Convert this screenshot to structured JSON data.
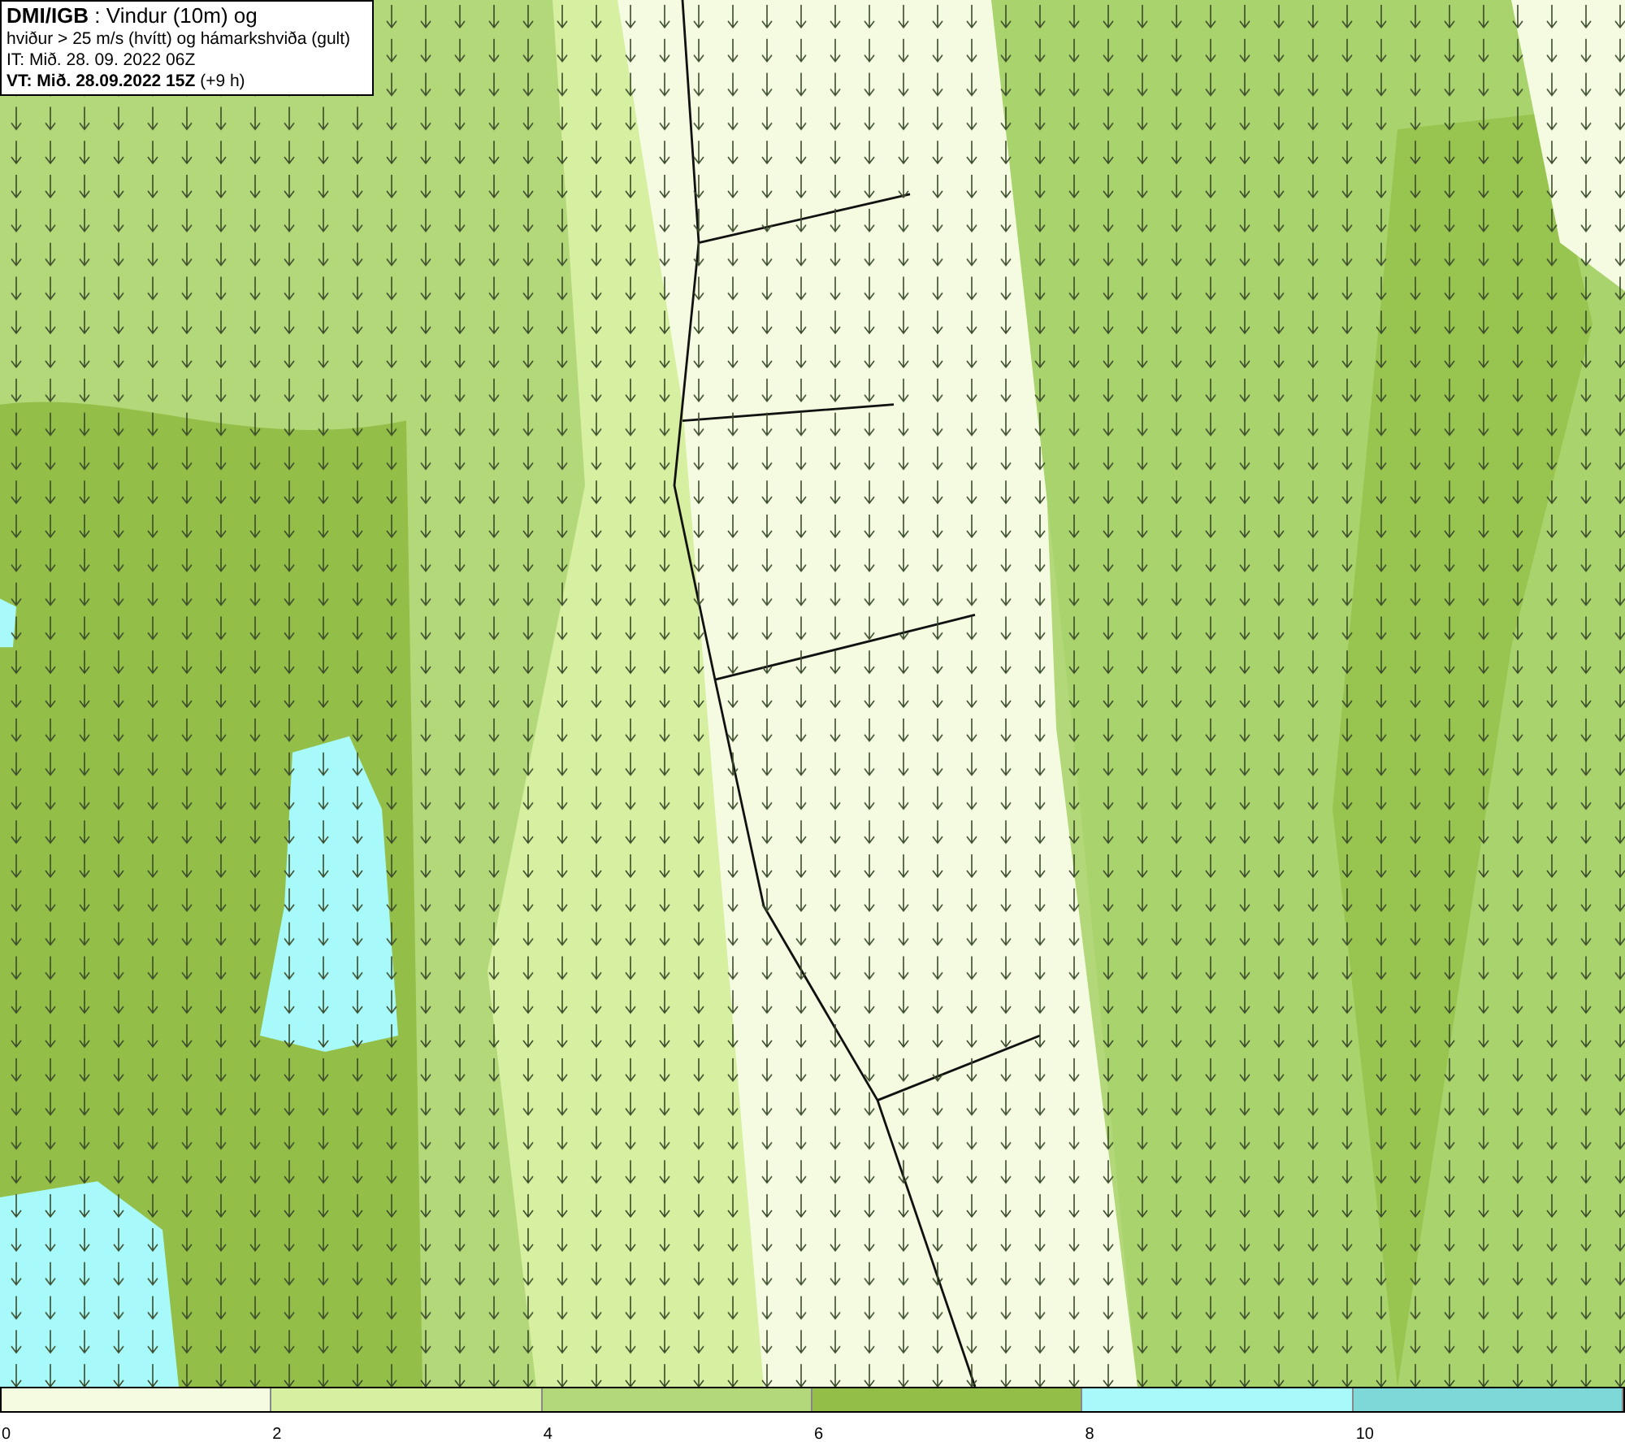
{
  "info_box": {
    "lines": [
      "**DMI/IGB** : Vindur (10m) og",
      "hviður > 25 m/s (hvítt) og hámarkshviða (gult)",
      "IT: Mið. 28. 09. 2022 06Z",
      "**VT: Mið. 28.09.2022 15Z** (+9 h)"
    ]
  },
  "colorbar": {
    "segments": [
      {
        "color": "#f5fbe0"
      },
      {
        "color": "#d6efa0"
      },
      {
        "color": "#b3d87a"
      },
      {
        "color": "#93bf48"
      },
      {
        "color": "#a8fafa"
      },
      {
        "color": "#7fd8d8"
      }
    ],
    "ticks": [
      "0",
      "2",
      "4",
      "6",
      "8",
      "10"
    ]
  }
}
